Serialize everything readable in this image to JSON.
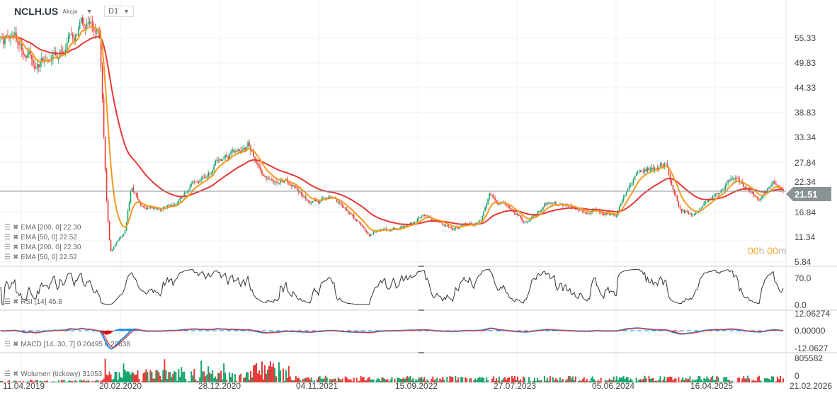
{
  "header": {
    "symbol": "NCLH.US",
    "type": "Akcje",
    "timeframe": "D1"
  },
  "colors": {
    "up": "#14a36b",
    "down": "#e53935",
    "ema200": "#e53935",
    "ema50": "#f59a1b",
    "rsi": "#333333",
    "macd": "#1e88e5",
    "signal": "#e53935"
  },
  "price_axis": [
    "55.33",
    "49.83",
    "44.33",
    "38.83",
    "33.34",
    "27.84",
    "22.34",
    "16.84",
    "11.34",
    "5.84"
  ],
  "current_price": "21.51",
  "timer": {
    "h": "00",
    "hu": "h",
    "m": "00",
    "mu": "m"
  },
  "indicators": {
    "ema1": "EMA [200, 0] 22.30",
    "ema2": "EMA [50, 0] 22.52",
    "ema3": "EMA [200, 0] 22.30",
    "ema4": "EMA [50, 0] 22.52",
    "rsi": "RSI [14] 45.8",
    "macd": "MACD [14, 30, 7] 0.20495 0.20638",
    "volume": "Wolumen (tickowy) 31053"
  },
  "rsi_axis": [
    "70.0",
    "0.0"
  ],
  "macd_axis": [
    "12.06274",
    "0.00000",
    "-12.0627"
  ],
  "volume_axis": [
    "805582",
    "0"
  ],
  "dates": [
    "11.04.2019",
    "20.02.2020",
    "28.12.2020",
    "04.11.2021",
    "15.09.2022",
    "27.07.2023",
    "05.06.2024",
    "16.04.2025",
    "21.02.2026"
  ],
  "chart_data": {
    "type": "candlestick",
    "x_unit": "months since Apr 2019",
    "anchors": [
      [
        0,
        57
      ],
      [
        3.6,
        50
      ],
      [
        5.8,
        52
      ],
      [
        8.8,
        58
      ],
      [
        10.2,
        54
      ],
      [
        10.9,
        20
      ],
      [
        11.3,
        8
      ],
      [
        12.8,
        12
      ],
      [
        13.5,
        22
      ],
      [
        14.6,
        18
      ],
      [
        18.2,
        18
      ],
      [
        19.7,
        24
      ],
      [
        22.6,
        29
      ],
      [
        25.5,
        32
      ],
      [
        27,
        25
      ],
      [
        29.2,
        25
      ],
      [
        31.4,
        20
      ],
      [
        34.3,
        20
      ],
      [
        36.5,
        15
      ],
      [
        38,
        12
      ],
      [
        40.9,
        13
      ],
      [
        43.8,
        16
      ],
      [
        46.7,
        13
      ],
      [
        49.6,
        15
      ],
      [
        50.4,
        21
      ],
      [
        52.6,
        18
      ],
      [
        54,
        15
      ],
      [
        56.2,
        19
      ],
      [
        59.9,
        17
      ],
      [
        63.5,
        17
      ],
      [
        65.7,
        26
      ],
      [
        68.6,
        27
      ],
      [
        70,
        18
      ],
      [
        71.5,
        16
      ],
      [
        73.7,
        22
      ],
      [
        75.9,
        25
      ],
      [
        78.1,
        19
      ],
      [
        79.6,
        23
      ],
      [
        80.7,
        21.5
      ]
    ],
    "ylim": [
      5.84,
      55.33
    ]
  }
}
